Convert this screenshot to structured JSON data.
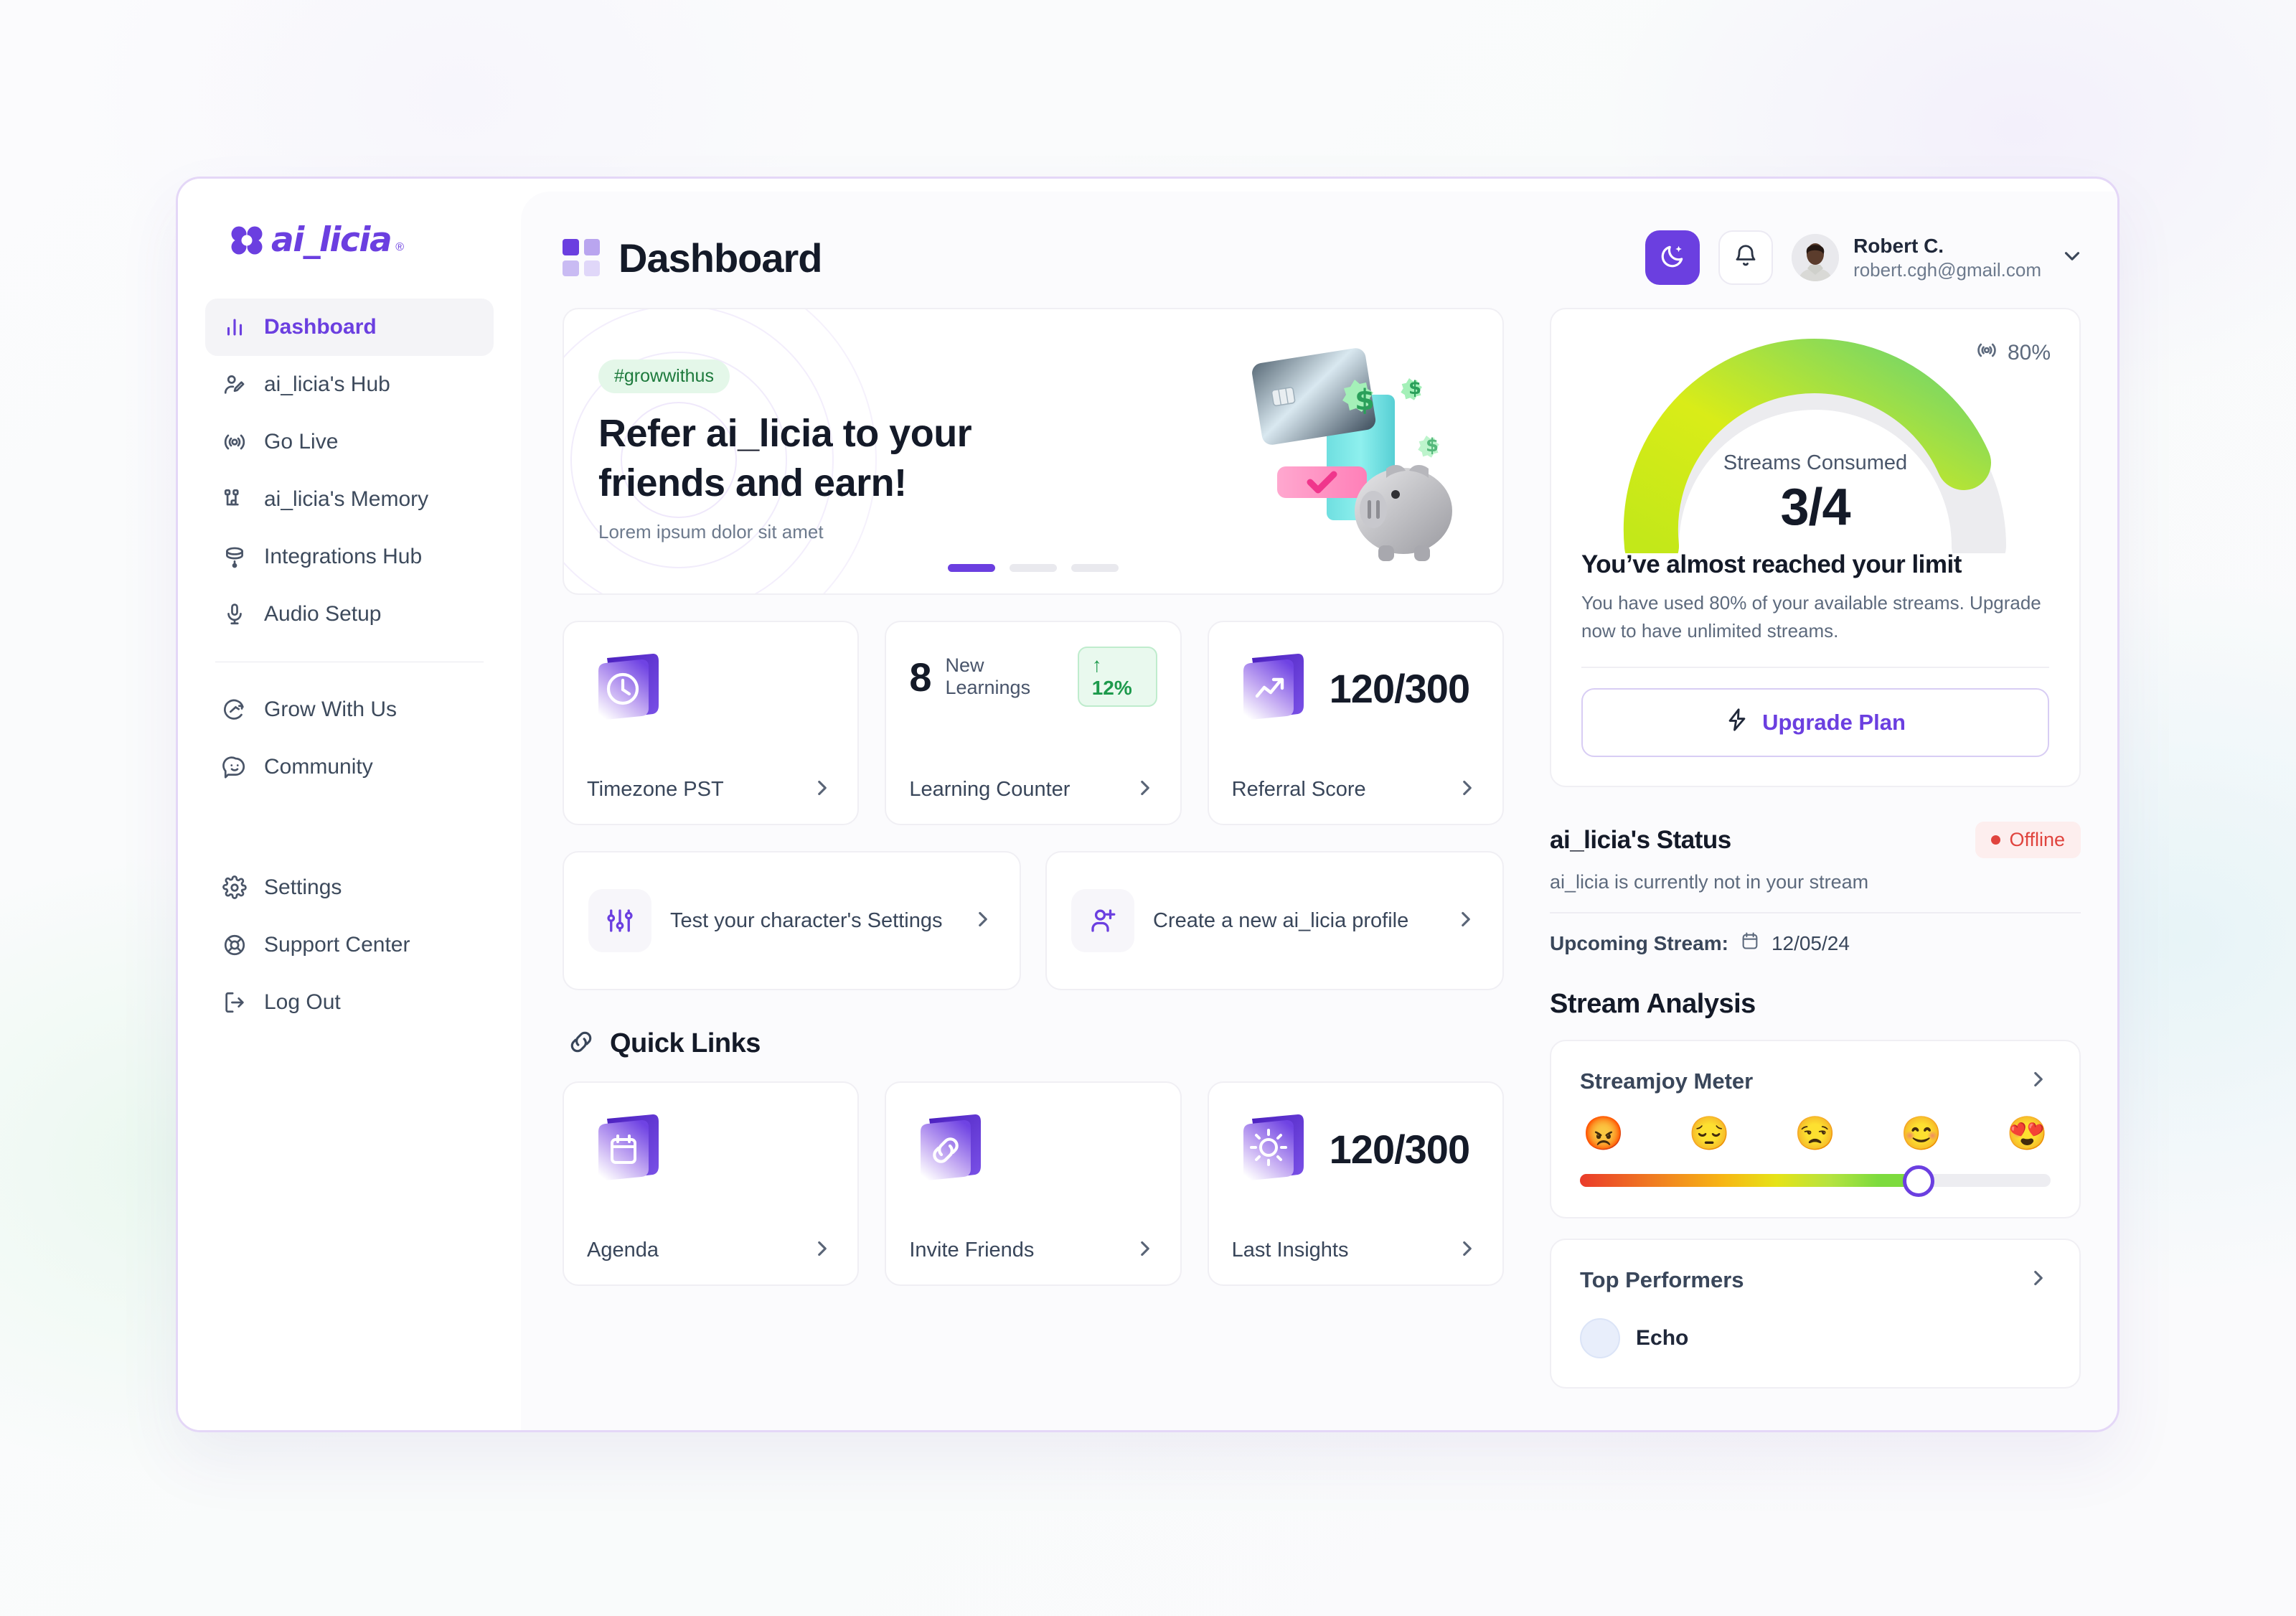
{
  "brand": {
    "name": "ai_licia",
    "registered": "®",
    "accent": "#6b3fe0"
  },
  "sidebar": {
    "items": [
      {
        "label": "Dashboard",
        "icon": "bar-chart-icon",
        "active": true
      },
      {
        "label": "ai_licia's Hub",
        "icon": "user-edit-icon",
        "active": false
      },
      {
        "label": "Go Live",
        "icon": "broadcast-icon",
        "active": false
      },
      {
        "label": "ai_licia's Memory",
        "icon": "memory-nodes-icon",
        "active": false
      },
      {
        "label": "Integrations Hub",
        "icon": "database-icon",
        "active": false
      },
      {
        "label": "Audio Setup",
        "icon": "microphone-icon",
        "active": false
      }
    ],
    "secondary": [
      {
        "label": "Grow With Us",
        "icon": "growth-smiley-icon"
      },
      {
        "label": "Community",
        "icon": "chat-smiley-icon"
      }
    ],
    "footer": [
      {
        "label": "Settings",
        "icon": "gear-icon"
      },
      {
        "label": "Support Center",
        "icon": "lifebuoy-icon"
      },
      {
        "label": "Log Out",
        "icon": "logout-icon"
      }
    ]
  },
  "header": {
    "title": "Dashboard",
    "theme_toggle_icon": "moon-star-icon",
    "notifications_icon": "bell-icon",
    "user": {
      "name": "Robert C.",
      "email": "robert.cgh@gmail.com",
      "avatar": "user-avatar",
      "caret_icon": "chevron-down-icon"
    }
  },
  "hero": {
    "tag": "#growwithus",
    "headline_line1": "Refer ai_licia to your",
    "headline_line2": "friends and earn!",
    "subtext": "Lorem ipsum dolor sit amet",
    "illustration": "credit-card-piggy-bank-illustration",
    "carousel": {
      "total": 3,
      "active_index": 0
    }
  },
  "stats": [
    {
      "icon": "clock-folder-icon",
      "value": "",
      "mini": "",
      "pill": "",
      "label": "Timezone PST",
      "chevron": "chevron-right-icon"
    },
    {
      "icon": "",
      "value": "8",
      "mini": "New Learnings",
      "pill": "↑ 12%",
      "label": "Learning Counter",
      "chevron": "chevron-right-icon"
    },
    {
      "icon": "trend-folder-icon",
      "value": "120/300",
      "mini": "",
      "pill": "",
      "label": "Referral Score",
      "chevron": "chevron-right-icon"
    }
  ],
  "actions": [
    {
      "icon": "sliders-icon",
      "label": "Test your character's Settings",
      "chevron": "chevron-right-icon"
    },
    {
      "icon": "user-plus-icon",
      "label": "Create a new ai_licia profile",
      "chevron": "chevron-right-icon"
    }
  ],
  "quick_links": {
    "title": "Quick Links",
    "icon": "link-chain-icon",
    "items": [
      {
        "icon": "calendar-folder-icon",
        "value": "",
        "label": "Agenda",
        "chevron": "chevron-right-icon"
      },
      {
        "icon": "link-folder-icon",
        "value": "",
        "label": "Invite Friends",
        "chevron": "chevron-right-icon"
      },
      {
        "icon": "bulb-folder-icon",
        "value": "120/300",
        "label": "Last Insights",
        "chevron": "chevron-right-icon"
      }
    ]
  },
  "usage": {
    "badge_icon": "broadcast-icon",
    "badge_percent": "80%",
    "gauge_caption": "Streams Consumed",
    "gauge_value": "3/4",
    "limit_heading": "You’ve almost reached your limit",
    "limit_text": "You have used 80% of your available streams. Upgrade now to have unlimited streams.",
    "upgrade_label": "Upgrade Plan",
    "upgrade_icon": "lightning-bolt-icon"
  },
  "status": {
    "title": "ai_licia's Status",
    "badge": "Offline",
    "badge_color": "#e0443e",
    "description": "ai_licia is currently not in your stream",
    "upcoming_label": "Upcoming Stream:",
    "upcoming_icon": "calendar-icon",
    "upcoming_date": "12/05/24"
  },
  "analysis": {
    "section_title": "Stream Analysis",
    "streamjoy": {
      "title": "Streamjoy Meter",
      "chevron": "chevron-right-icon",
      "emojis": [
        "😡",
        "😔",
        "😒",
        "😊",
        "😍"
      ],
      "value_percent": 72
    },
    "top_performers": {
      "title": "Top Performers",
      "chevron": "chevron-right-icon",
      "rows": [
        {
          "name": "Echo",
          "avatar": "performer-avatar"
        }
      ]
    }
  },
  "chart_data": {
    "type": "gauge",
    "title": "Streams Consumed",
    "value": 3,
    "max": 4,
    "percent": 80,
    "display": "3/4",
    "colors": [
      "#d4ec1b",
      "#79d96a"
    ],
    "track_color": "#ececef"
  }
}
